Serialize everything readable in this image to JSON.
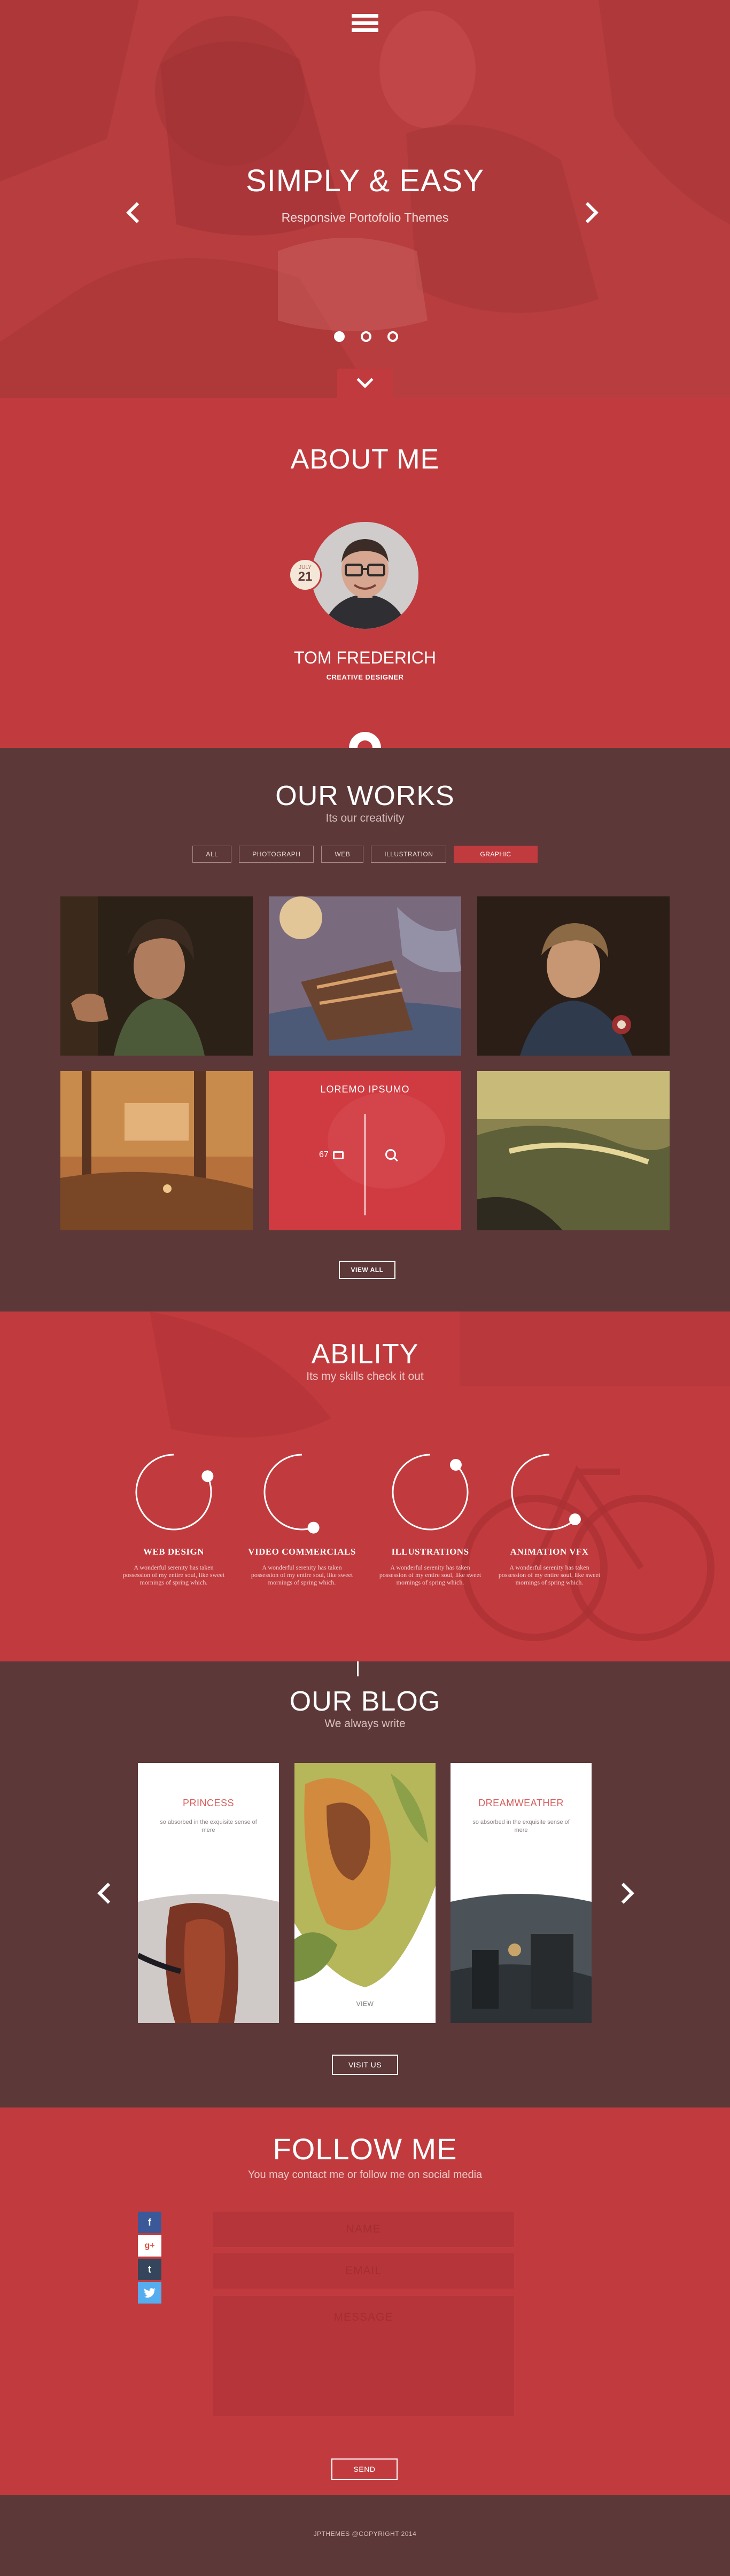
{
  "hero": {
    "title": "SIMPLY & EASY",
    "subtitle": "Responsive Portofolio Themes",
    "slides_count": 3,
    "active_slide": 1
  },
  "about": {
    "title": "ABOUT ME",
    "date_month": "JULY",
    "date_day": "21",
    "name": "TOM FREDERICH",
    "role": "CREATIVE DESIGNER"
  },
  "works": {
    "title": "OUR WORKS",
    "subtitle": "Its our creativity",
    "filters": [
      {
        "label": "ALL",
        "active": false
      },
      {
        "label": "PHOTOGRAPH",
        "active": false
      },
      {
        "label": "WEB",
        "active": false
      },
      {
        "label": "ILLUSTRATION",
        "active": false
      },
      {
        "label": "GRAPHIC",
        "active": true
      }
    ],
    "hover_tile": {
      "title": "LOREMO IPSUMO",
      "count": "67"
    },
    "view_all": "VIEW ALL"
  },
  "ability": {
    "title": "ABILITY",
    "subtitle": "Its my skills check it out",
    "skills": [
      {
        "name": "WEB DESIGN",
        "desc": "A wonderful serenity has taken possession of my entire soul, like sweet mornings of spring which.",
        "level": 0.82
      },
      {
        "name": "VIDEO COMMERCIALS",
        "desc": "A wonderful serenity has taken possession of my entire soul, like sweet mornings of spring which.",
        "level": 0.55
      },
      {
        "name": "ILLUSTRATIONS",
        "desc": "A wonderful serenity has taken possession of my entire soul, like sweet mornings of spring which.",
        "level": 0.88
      },
      {
        "name": "ANIMATION VFX",
        "desc": "A wonderful serenity has taken possession of my entire soul, like sweet mornings of spring which.",
        "level": 0.62
      }
    ]
  },
  "blog": {
    "title": "OUR BLOG",
    "subtitle": "We always write",
    "cards": [
      {
        "title": "PRINCESS",
        "text": "so absorbed in the exquisite sense of mere"
      },
      {
        "view": "VIEW"
      },
      {
        "title": "DREAMWEATHER",
        "text": "so absorbed in the exquisite sense of mere"
      }
    ],
    "visit": "VISIT US"
  },
  "follow": {
    "title": "FOLLOW ME",
    "subtitle": "You may contact me or follow me on social media",
    "social": [
      {
        "icon": "facebook-icon",
        "glyph": "f"
      },
      {
        "icon": "google-plus-icon",
        "glyph": "g+"
      },
      {
        "icon": "tumblr-icon",
        "glyph": "t"
      },
      {
        "icon": "twitter-icon",
        "glyph": "🐦"
      }
    ],
    "name_placeholder": "NAME",
    "email_placeholder": "EMAIL",
    "message_placeholder": "MESSAGE",
    "send": "SEND"
  },
  "footer": {
    "copyright": "JPTHEMES @COPYRIGHT 2014"
  },
  "colors": {
    "red": "#c13b3e",
    "maroon": "#5d3838",
    "tile_hover": "#cf3b41"
  }
}
